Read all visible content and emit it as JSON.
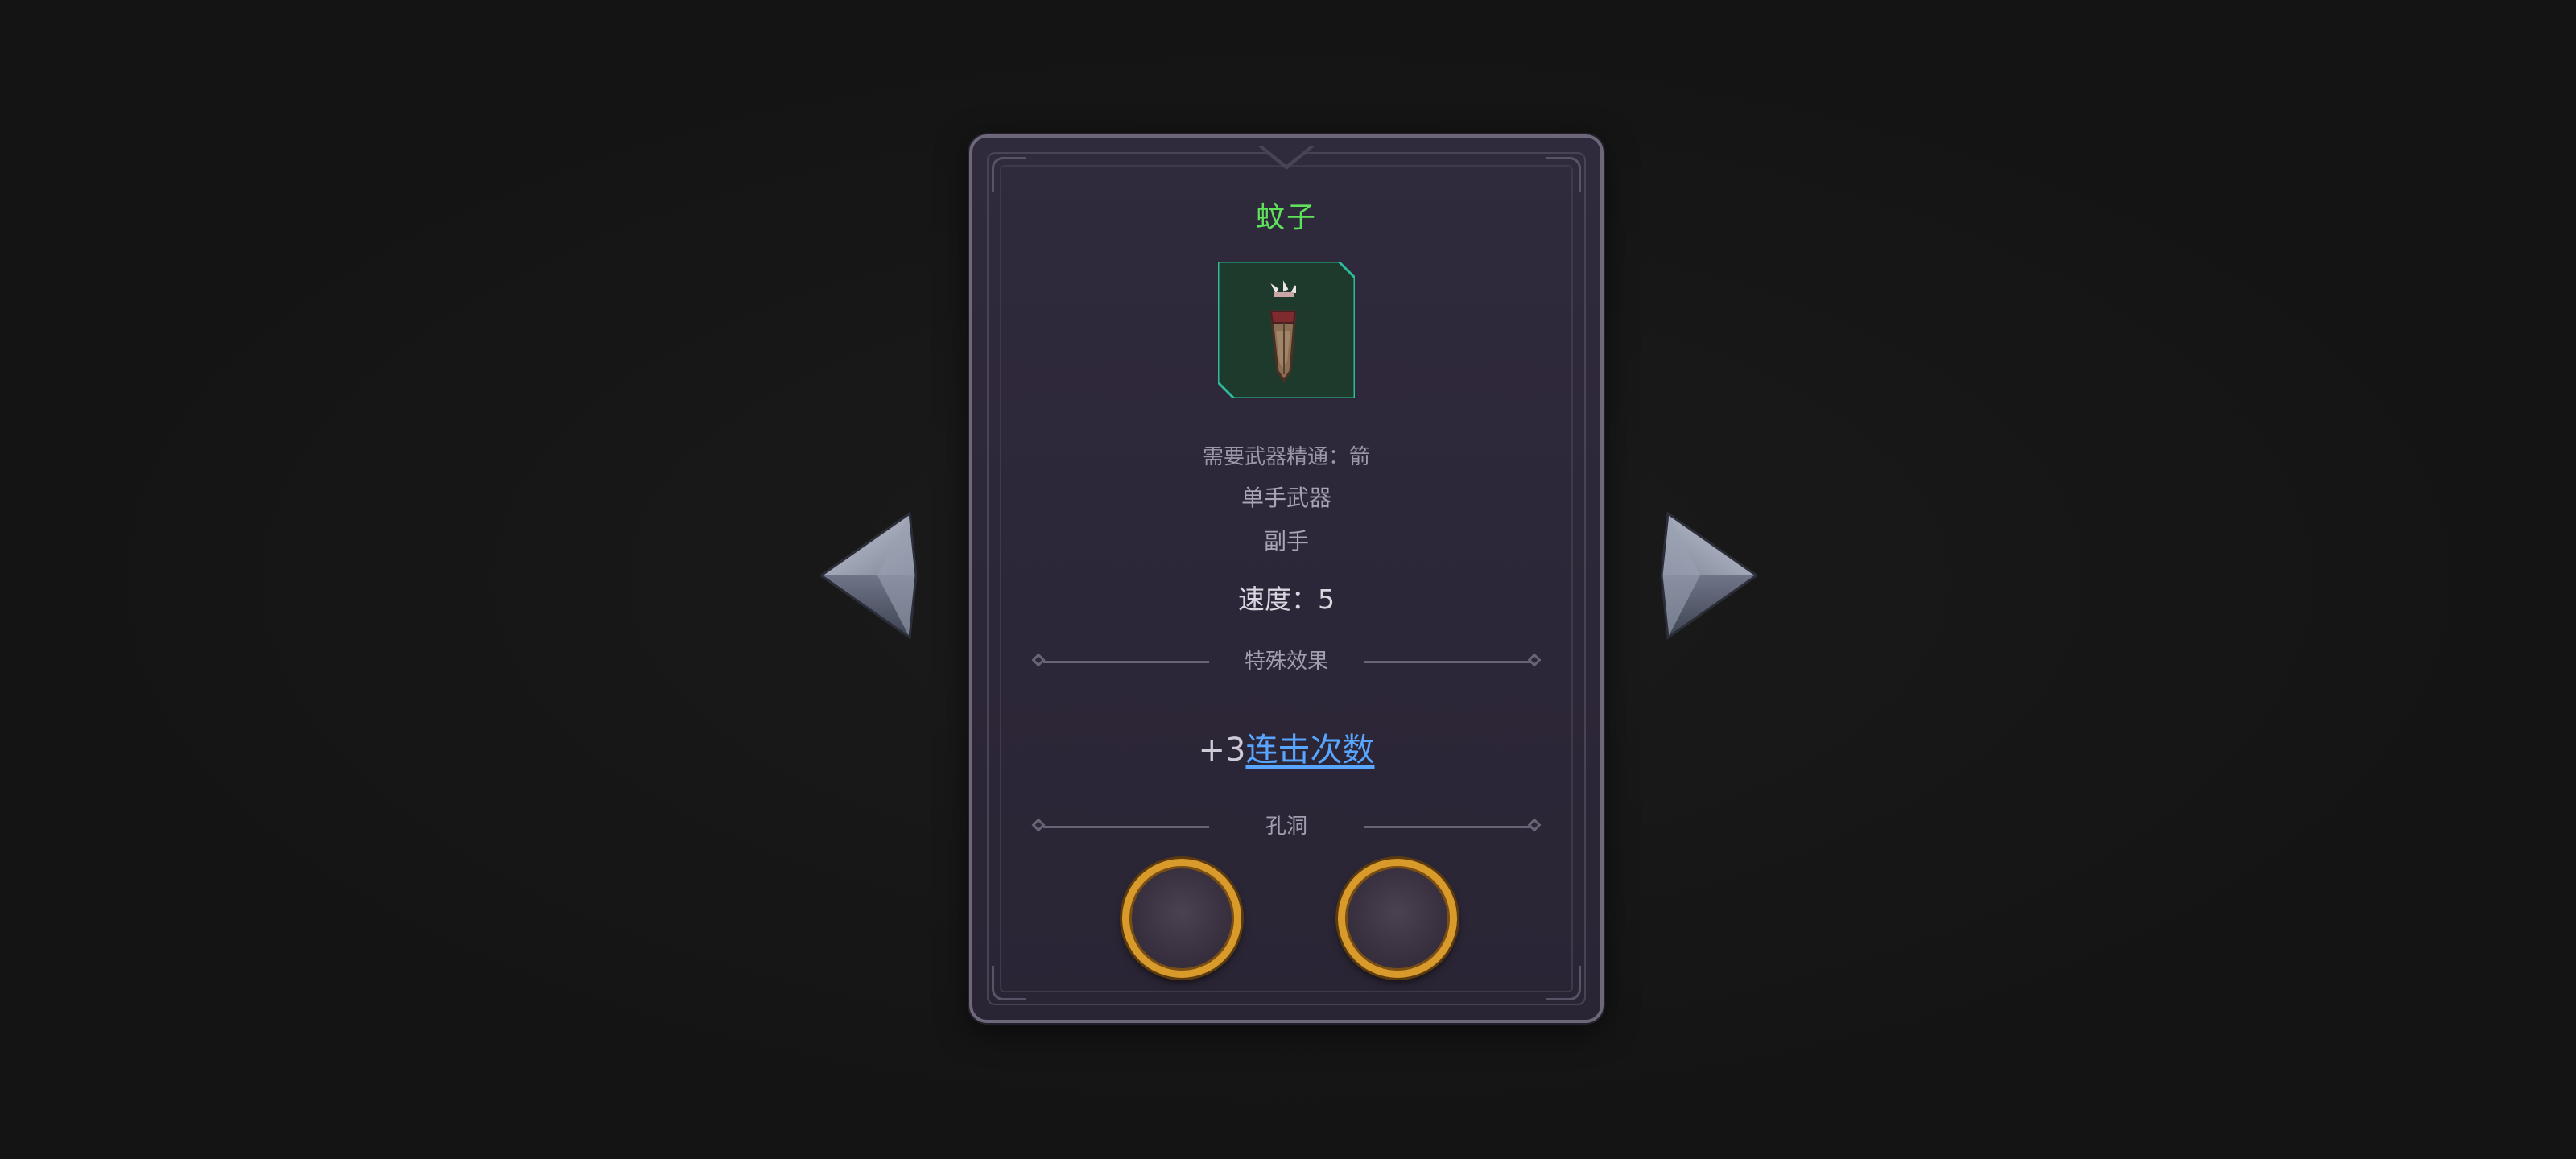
{
  "item": {
    "name": "蚊子",
    "name_color": "#5fe25a",
    "icon": "arrow-quiver-icon",
    "requirement": "需要武器精通：箭",
    "hand_type": "单手武器",
    "slot": "副手",
    "speed": "速度：5"
  },
  "effects": {
    "header": "特殊效果",
    "items": [
      {
        "prefix": "+3",
        "link_label": "连击次数",
        "link_color": "#58a6ff"
      }
    ]
  },
  "sockets": {
    "header": "孔洞",
    "count": 2
  },
  "nav": {
    "prev_icon": "left-arrow-icon",
    "next_icon": "right-arrow-icon"
  }
}
